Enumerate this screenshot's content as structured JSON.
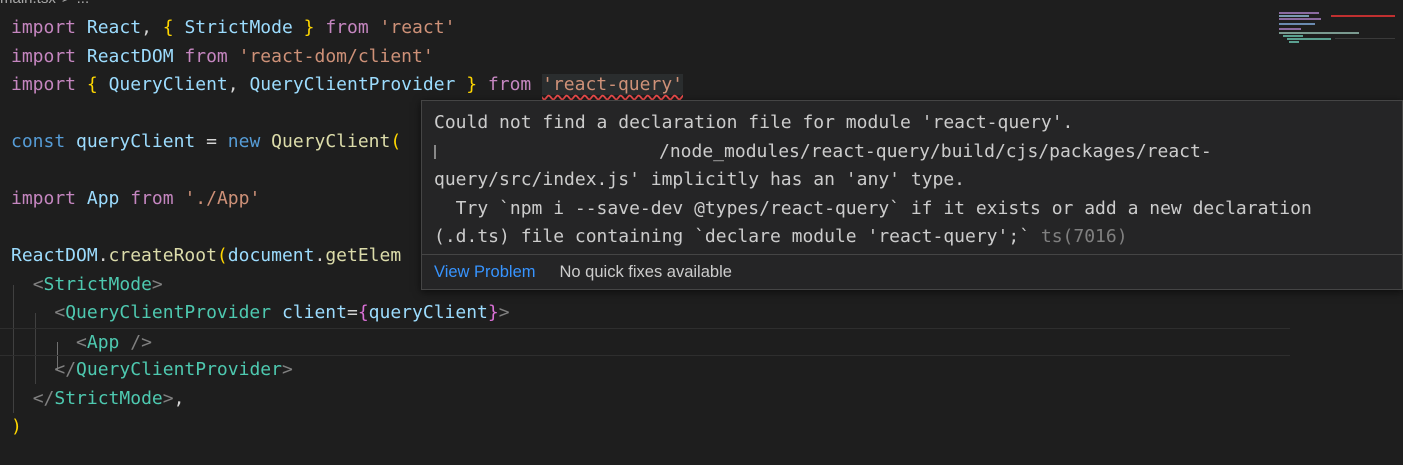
{
  "breadcrumb": {
    "file": "main.tsx",
    "sep": ">",
    "more": "..."
  },
  "code": {
    "l1": {
      "kw": "import",
      "react": "React",
      "comma": ",",
      "lb": "{",
      "strict": "StrictMode",
      "rb": "}",
      "from": "from",
      "mod": "'react'"
    },
    "l2": {
      "kw": "import",
      "name": "ReactDOM",
      "from": "from",
      "mod": "'react-dom/client'"
    },
    "l3": {
      "kw": "import",
      "lb": "{",
      "qc": "QueryClient",
      "comma": ",",
      "qcp": "QueryClientProvider",
      "rb": "}",
      "from": "from",
      "mod": "'react-query'"
    },
    "l5": {
      "kw": "const",
      "name": "queryClient",
      "eq": "=",
      "new": "new",
      "cls": "QueryClient",
      "paren": "("
    },
    "l7": {
      "kw": "import",
      "name": "App",
      "from": "from",
      "mod": "'./App'"
    },
    "l9": {
      "obj": "ReactDOM",
      "dot": ".",
      "fn": "createRoot",
      "paren": "(",
      "doc": "document",
      "dot2": ".",
      "fn2": "getElem"
    },
    "l10": {
      "open": "<",
      "tag": "StrictMode",
      "close": ">"
    },
    "l11": {
      "open": "<",
      "tag": "QueryClientProvider",
      "attr": "client",
      "eq": "=",
      "lb": "{",
      "val": "queryClient",
      "rb": "}",
      "close": ">"
    },
    "l12": {
      "open": "<",
      "tag": "App",
      "close": " />"
    },
    "l13": {
      "open": "</",
      "tag": "QueryClientProvider",
      "close": ">"
    },
    "l14": {
      "open": "</",
      "tag": "StrictMode",
      "close": ">",
      "comma": ","
    },
    "l15": {
      "paren": ")"
    }
  },
  "hover": {
    "line1": "Could not find a declaration file for module 'react-query'.",
    "line2": "/node_modules/react-query/build/cjs/packages/react-",
    "line3": "query/src/index.js' implicitly has an 'any' type.",
    "line4": "  Try `npm i --save-dev @types/react-query` if it exists or add a new declaration",
    "line5": "(.d.ts) file containing `declare module 'react-query';` ",
    "code": "ts(7016)",
    "view_problem": "View Problem",
    "no_fixes": "No quick fixes available"
  },
  "colors": {
    "background": "#1e1e1e",
    "hover_bg": "#252526",
    "link": "#3794ff",
    "error": "#f14c4c"
  }
}
